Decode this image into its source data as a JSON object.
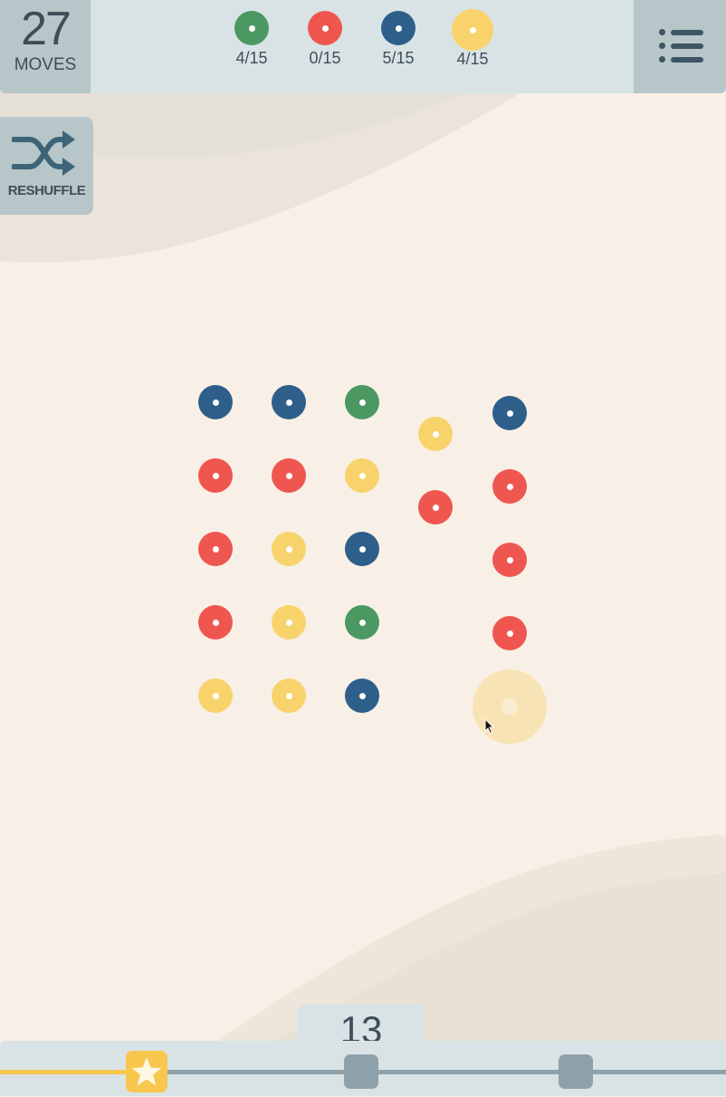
{
  "moves": {
    "count": "27",
    "label": "MOVES"
  },
  "goals": [
    {
      "color": "#4c9863",
      "count": "4/15"
    },
    {
      "color": "#ef5650",
      "count": "0/15"
    },
    {
      "color": "#2e5f8b",
      "count": "5/15"
    },
    {
      "color": "#f8d36c",
      "count": "4/15"
    }
  ],
  "reshuffle": {
    "label": "RESHUFFLE",
    "icon": "shuffle-icon"
  },
  "menu": {
    "icon": "list-icon"
  },
  "colors": {
    "green": "#4c9863",
    "red": "#ef5650",
    "blue": "#2e5f8b",
    "yellow": "#f8d36c",
    "background": "#f8f0e6",
    "panel": "#d9e3e5",
    "accent": "#f7c74e"
  },
  "board": {
    "columns": [
      [
        "blue",
        "red",
        "red",
        "red",
        "yellow"
      ],
      [
        "blue",
        "red",
        "yellow",
        "yellow",
        "yellow"
      ],
      [
        "green",
        "yellow",
        "blue",
        "green",
        "blue"
      ],
      [
        "yellow",
        "red"
      ],
      [
        "blue",
        "red",
        "red",
        "red",
        "yellow"
      ]
    ],
    "highlighted": {
      "column": 5,
      "row": 5
    }
  },
  "score": {
    "value": "13",
    "progress": 0.2
  },
  "milestones": [
    {
      "icon": "star-icon",
      "reached": true
    },
    {
      "reached": false
    },
    {
      "reached": false
    }
  ]
}
